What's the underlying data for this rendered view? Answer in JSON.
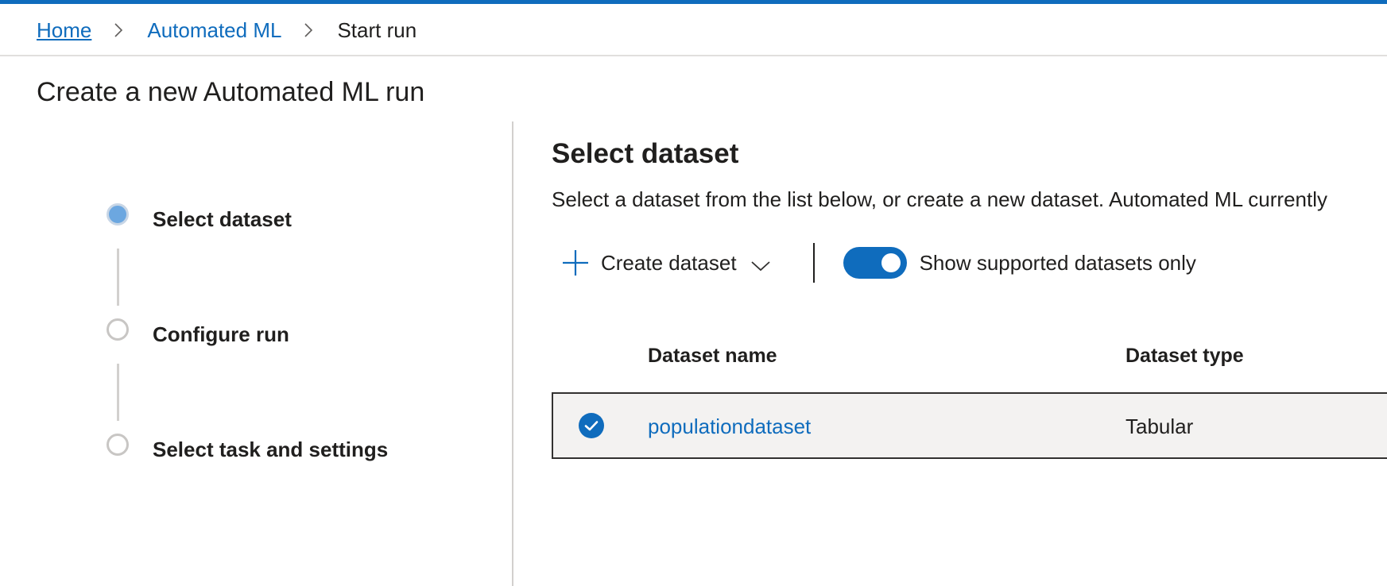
{
  "colors": {
    "accent": "#0f6cbd",
    "divider": "#d2d0ce",
    "row_selected_bg": "#f3f2f1",
    "step_active": "#6ca7e0"
  },
  "breadcrumb": {
    "items": [
      {
        "label": "Home"
      },
      {
        "label": "Automated ML"
      },
      {
        "label": "Start run"
      }
    ],
    "separator_icon": "chevron-right-icon"
  },
  "page": {
    "title": "Create a new Automated ML run"
  },
  "stepper": {
    "steps": [
      {
        "label": "Select dataset",
        "state": "active"
      },
      {
        "label": "Configure run",
        "state": "inactive"
      },
      {
        "label": "Select task and settings",
        "state": "inactive"
      }
    ]
  },
  "main": {
    "section_title": "Select dataset",
    "description": "Select a dataset from the list below, or create a new dataset. Automated ML currently",
    "toolbar": {
      "create_label": "Create dataset",
      "create_icon": "plus-icon",
      "create_dropdown_icon": "chevron-down-icon",
      "toggle_label": "Show supported datasets only",
      "toggle_on": true
    },
    "table": {
      "columns": [
        "Dataset name",
        "Dataset type"
      ],
      "rows": [
        {
          "name": "populationdataset",
          "type": "Tabular",
          "selected": true
        }
      ]
    }
  }
}
